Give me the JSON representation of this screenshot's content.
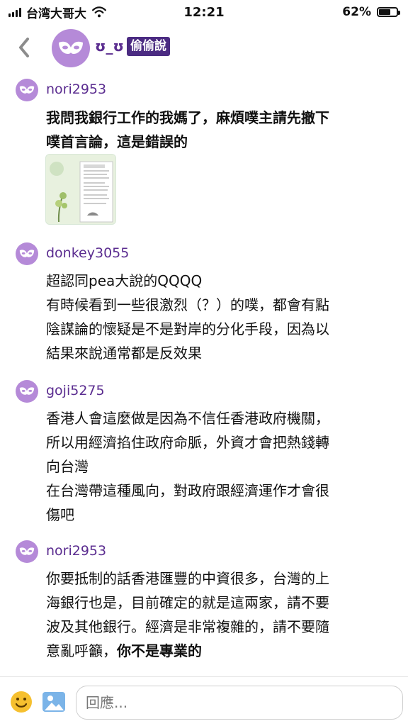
{
  "status_bar": {
    "carrier": "台湾大哥大",
    "time": "12:21",
    "battery_percent": "62%",
    "battery_level": 0.62
  },
  "header": {
    "title": "ʊ_ʊ",
    "badge": "偷偷說"
  },
  "comments": [
    {
      "username": "nori2953",
      "lines": [
        "我問我銀行工作的我媽了，麻煩噗主請先撤下",
        "噗首言論，這是錯誤的"
      ],
      "bold": true
    },
    {
      "username": "donkey3055",
      "lines": [
        "超認同pea大說的QQQQ",
        "有時候看到一些很激烈（？）的噗，都會有點",
        "陰謀論的懷疑是不是對岸的分化手段，因為以",
        "結果來說通常都是反效果"
      ]
    },
    {
      "username": "goji5275",
      "lines": [
        "香港人會這麼做是因為不信任香港政府機關，",
        "所以用經濟掐住政府命脈，外資才會把熱錢轉",
        "向台灣",
        "在台灣帶這種風向，對政府跟經濟運作才會很",
        "傷吧"
      ]
    },
    {
      "username": "nori2953",
      "lines": [
        "你要抵制的話香港匯豐的中資很多，台灣的上",
        "海銀行也是，目前確定的就是這兩家，請不要",
        "波及其他銀行。經濟是非常複雜的，請不要隨"
      ],
      "last_line_normal": "意亂呼籲，",
      "last_line_bold": "你不是專業的"
    }
  ],
  "bottom_bar": {
    "reply_placeholder": "回應..."
  },
  "colors": {
    "accent": "#5b2d90",
    "avatar": "#b58ad8",
    "badge": "#4b2b82"
  }
}
